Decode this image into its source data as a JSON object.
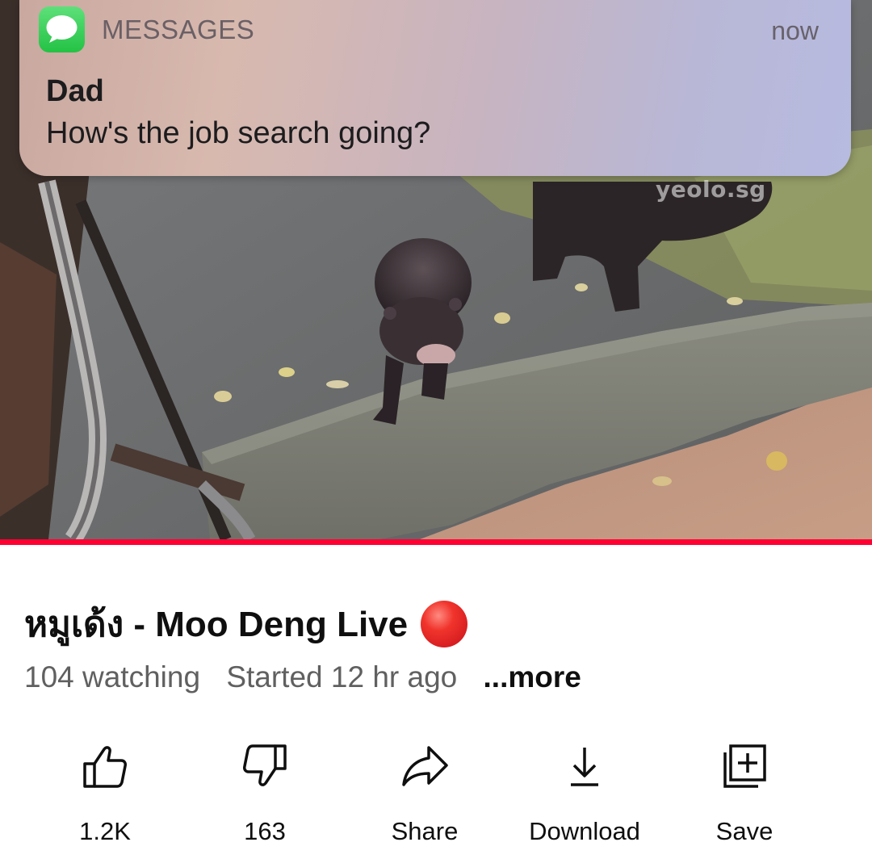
{
  "notification": {
    "app_name": "MESSAGES",
    "time": "now",
    "sender": "Dad",
    "message": "How's the job search going?",
    "app_icon": "messages-bubble-icon",
    "app_color": "#34c759"
  },
  "video": {
    "watermark": "yeolo.sg",
    "progress_color": "#ff0033",
    "progress_fraction": 1.0
  },
  "info": {
    "title": "หมูเด้ง - Moo Deng Live",
    "live_icon": "red-circle-icon",
    "watching": "104 watching",
    "started": "Started 12 hr ago",
    "more": "...more"
  },
  "actions": [
    {
      "label": "1.2K",
      "icon": "thumbs-up-icon"
    },
    {
      "label": "163",
      "icon": "thumbs-down-icon"
    },
    {
      "label": "Share",
      "icon": "share-arrow-icon"
    },
    {
      "label": "Download",
      "icon": "download-icon"
    },
    {
      "label": "Save",
      "icon": "save-to-playlist-icon"
    }
  ]
}
